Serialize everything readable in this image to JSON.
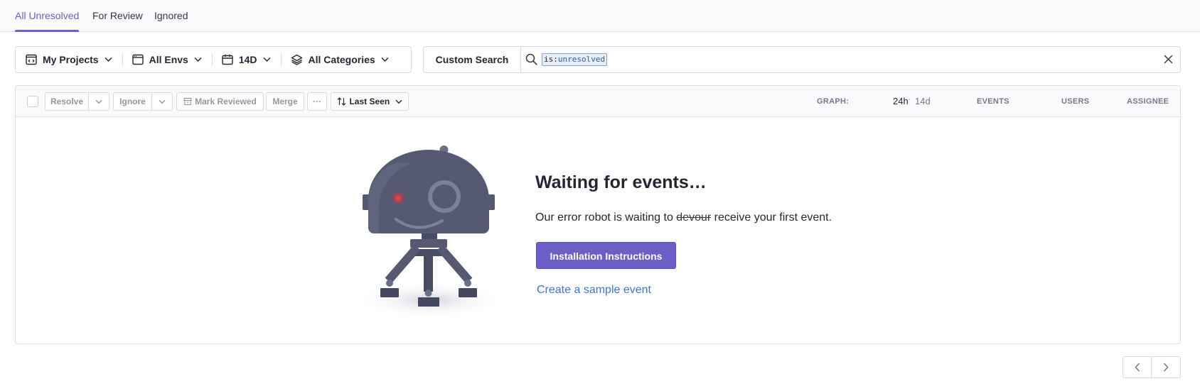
{
  "tabs": [
    {
      "label": "All Unresolved",
      "active": true
    },
    {
      "label": "For Review",
      "active": false
    },
    {
      "label": "Ignored",
      "active": false
    }
  ],
  "filters": {
    "projects": "My Projects",
    "environments": "All Envs",
    "period": "14D",
    "categories": "All Categories"
  },
  "search": {
    "custom_label": "Custom Search",
    "token_key": "is:",
    "token_value": "unresolved"
  },
  "toolbar": {
    "resolve": "Resolve",
    "ignore": "Ignore",
    "mark_reviewed": "Mark Reviewed",
    "merge": "Merge",
    "more": "···",
    "sort": "Last Seen"
  },
  "columns": {
    "graph": "GRAPH:",
    "period_24h": "24h",
    "period_14d": "14d",
    "events": "EVENTS",
    "users": "USERS",
    "assignee": "ASSIGNEE"
  },
  "empty_state": {
    "title": "Waiting for events…",
    "desc_before": "Our error robot is waiting to ",
    "desc_struck": "devour",
    "desc_after": " receive your first event.",
    "primary_button": "Installation Instructions",
    "sample_link": "Create a sample event"
  },
  "colors": {
    "accent": "#6c5fc7",
    "link": "#3d74db",
    "robot": "#555a72"
  }
}
